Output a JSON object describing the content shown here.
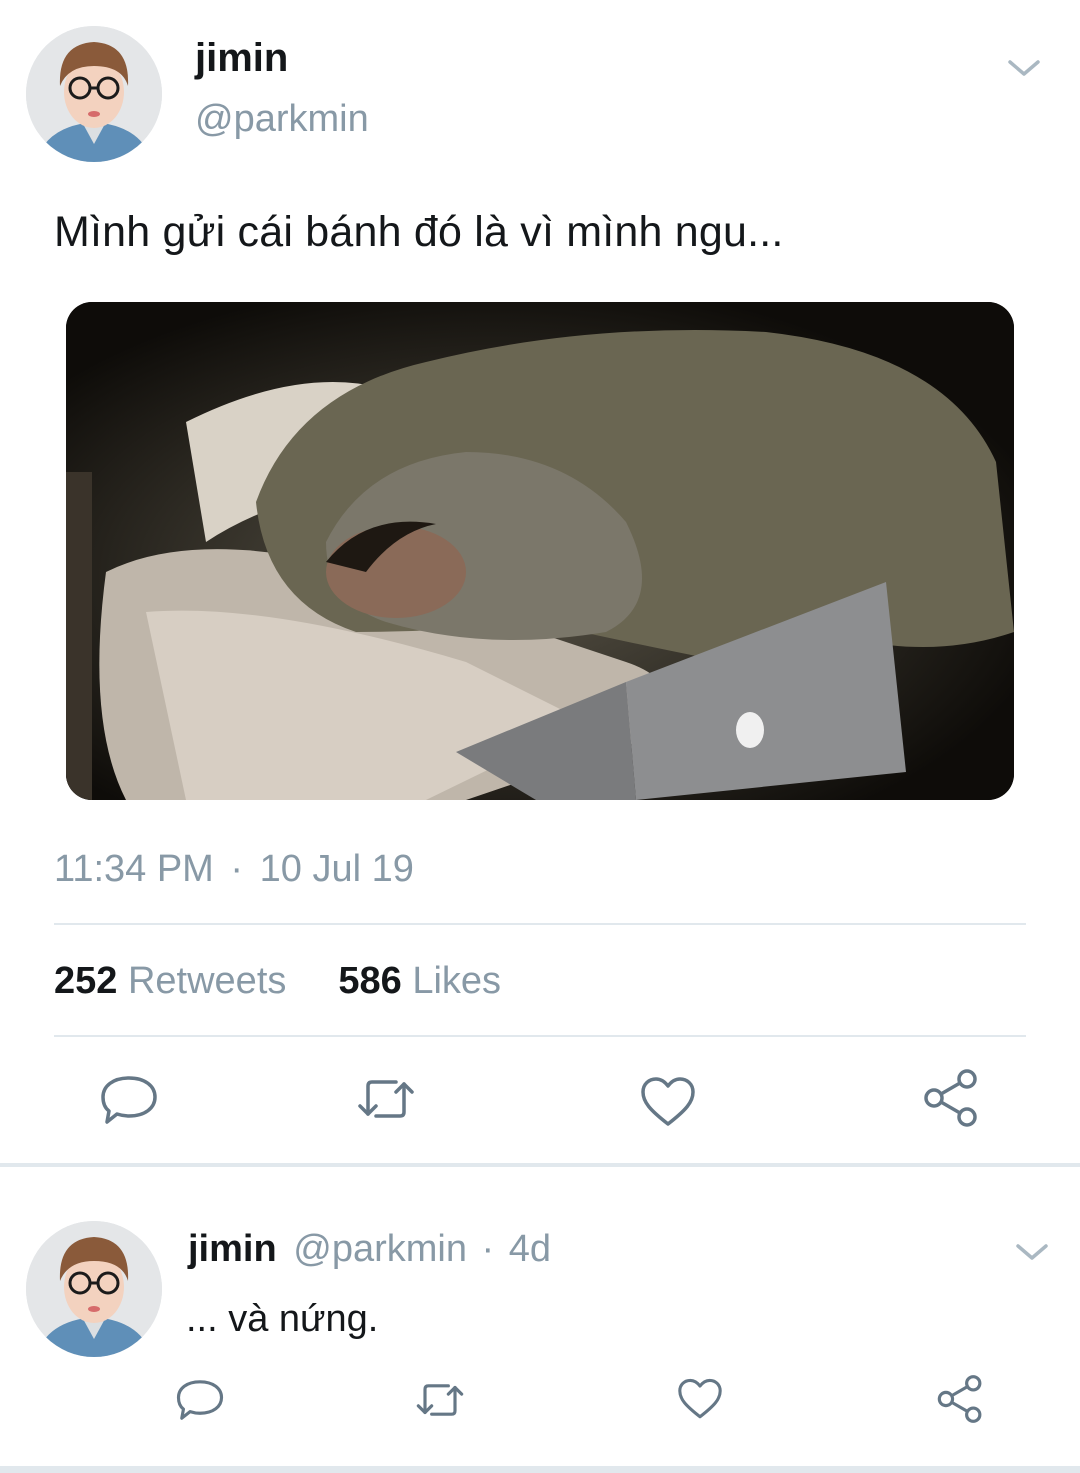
{
  "tweet": {
    "author_name": "jimin",
    "author_handle": "@parkmin",
    "text": "Mình gửi cái bánh đó là vì mình ngu...",
    "time": "11:34 PM",
    "separator": "·",
    "date": "10 Jul 19",
    "retweets_count": "252",
    "retweets_label": "Retweets",
    "likes_count": "586",
    "likes_label": "Likes"
  },
  "reply": {
    "author_name": "jimin",
    "author_handle": "@parkmin",
    "separator": "·",
    "age": "4d",
    "text": "... và nứng."
  },
  "icons": {
    "reply": "reply-icon",
    "retweet": "retweet-icon",
    "like": "heart-icon",
    "share": "share-icon",
    "more": "chevron-down-icon"
  },
  "colors": {
    "text_primary": "#14171a",
    "text_secondary": "#8899a6",
    "icon": "#657786",
    "divider": "#e1e8ed"
  }
}
